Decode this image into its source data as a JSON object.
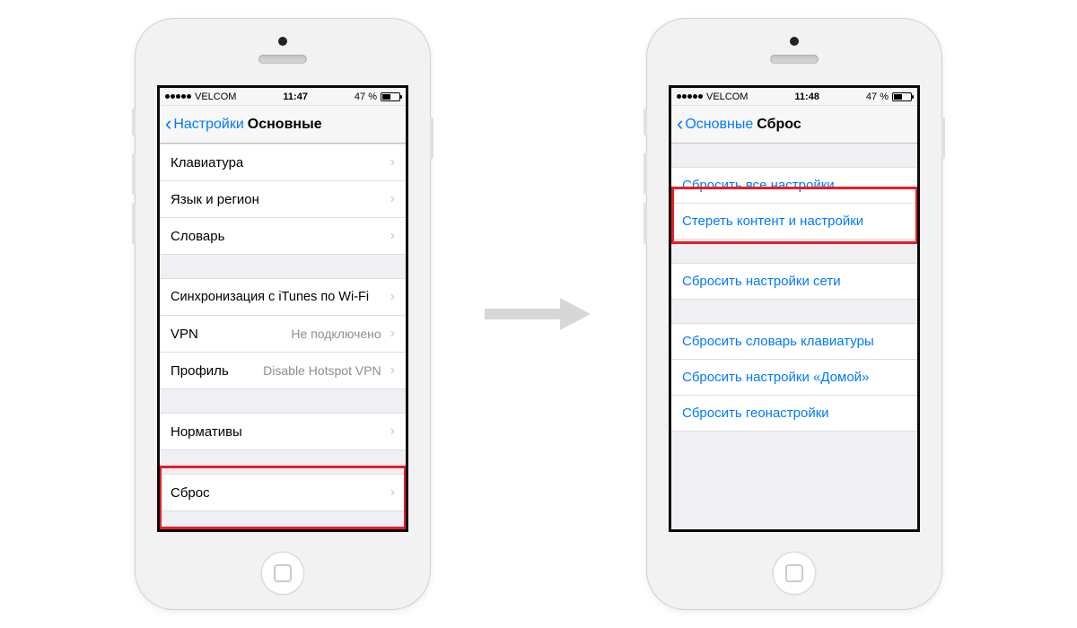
{
  "left": {
    "status": {
      "carrier": "VELCOM",
      "time": "11:47",
      "battery_pct": "47 %"
    },
    "nav": {
      "back": "Настройки",
      "title": "Основные"
    },
    "groupA": [
      {
        "label": "Клавиатура"
      },
      {
        "label": "Язык и регион"
      },
      {
        "label": "Словарь"
      }
    ],
    "groupB": [
      {
        "label": "Синхронизация c iTunes по Wi-Fi"
      },
      {
        "label": "VPN",
        "detail": "Не подключено"
      },
      {
        "label": "Профиль",
        "detail": "Disable Hotspot VPN"
      }
    ],
    "groupC": [
      {
        "label": "Нормативы"
      }
    ],
    "groupD": [
      {
        "label": "Сброс"
      }
    ]
  },
  "right": {
    "status": {
      "carrier": "VELCOM",
      "time": "11:48",
      "battery_pct": "47 %"
    },
    "nav": {
      "back": "Основные",
      "title": "Сброс"
    },
    "g1": [
      {
        "label": "Сбросить все настройки"
      },
      {
        "label": "Стереть контент и настройки"
      }
    ],
    "g2": [
      {
        "label": "Сбросить настройки сети"
      }
    ],
    "g3": [
      {
        "label": "Сбросить словарь клавиатуры"
      },
      {
        "label": "Сбросить настройки «Домой»"
      },
      {
        "label": "Сбросить геонастройки"
      }
    ]
  }
}
